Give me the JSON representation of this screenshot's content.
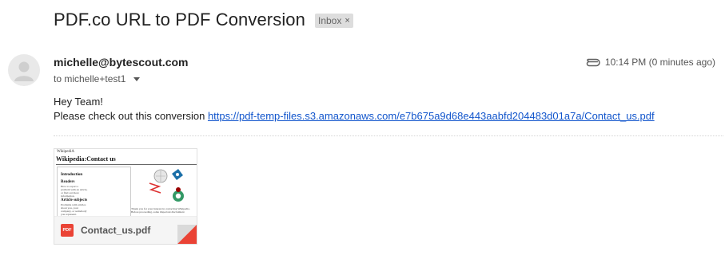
{
  "email": {
    "subject": "PDF.co URL to PDF Conversion",
    "label": "Inbox",
    "label_remove": "×",
    "sender": "michelle@bytescout.com",
    "recipient": "to michelle+test1",
    "time": "10:14 PM (0 minutes ago)",
    "body_line1": "Hey Team!",
    "body_line2": "Please check out this conversion",
    "link_text": "https://pdf-temp-files.s3.amazonaws.com/e7b675a9d68e443aabfd204483d01a7a/Contact_us.pdf"
  },
  "icons": {
    "avatar": "person-icon",
    "attachment_indicator": "paperclip-icon",
    "file_type": "pdf-icon",
    "recipient_details": "chevron-down-icon"
  },
  "attachment": {
    "file_name": "Contact_us.pdf",
    "file_type_label": "PDF",
    "preview": {
      "site_name": "WikipediA",
      "page_title": "Wikipedia:Contact us",
      "heading_intro": "Introduction",
      "heading_readers": "Readers",
      "readers_text": "How to report a problem with an article, or find out more information.",
      "heading_subjects": "Article subjects",
      "subjects_text": "Problems with articles about you, your company, or somebody you represent.",
      "thanks_text": "Thank you for your interest in contacting Wikipedia. Before proceeding, some important disclaimers:"
    }
  },
  "colors": {
    "link": "#1155cc",
    "pdf_red": "#ea4335",
    "chip_bg": "#dddddd"
  }
}
